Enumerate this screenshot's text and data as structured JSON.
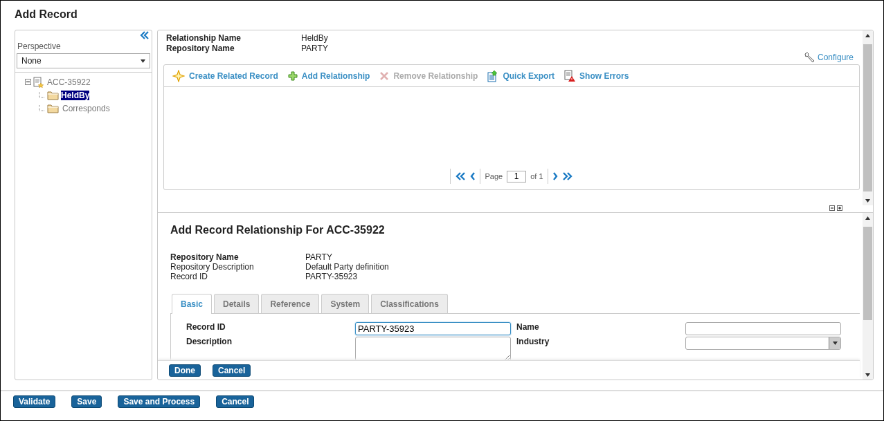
{
  "window": {
    "title": "Add Record"
  },
  "sidebar": {
    "perspective_label": "Perspective",
    "perspective_value": "None",
    "tree": [
      {
        "label": "ACC-35922",
        "expanded": true,
        "selected": false,
        "children": [
          {
            "label": "HeldBy",
            "selected": true
          },
          {
            "label": "Corresponds",
            "selected": false
          }
        ]
      }
    ]
  },
  "relationship": {
    "fields": [
      {
        "label": "Relationship Name",
        "value": "HeldBy"
      },
      {
        "label": "Repository Name",
        "value": "PARTY"
      }
    ],
    "configure": "Configure",
    "toolbar": [
      {
        "label": "Create Related Record",
        "disabled": false
      },
      {
        "label": "Add Relationship",
        "disabled": false
      },
      {
        "label": "Remove Relationship",
        "disabled": true
      },
      {
        "label": "Quick Export",
        "disabled": false
      },
      {
        "label": "Show Errors",
        "disabled": false
      }
    ],
    "pager": {
      "page_label": "Page",
      "page": "1",
      "of": "of 1"
    }
  },
  "form": {
    "title": "Add Record Relationship For ACC-35922",
    "info": [
      {
        "label": "Repository Name",
        "value": "PARTY",
        "bold": true
      },
      {
        "label": "Repository Description",
        "value": "Default Party definition",
        "bold": false
      },
      {
        "label": "Record ID",
        "value": "PARTY-35923",
        "bold": false
      }
    ],
    "tabs": [
      {
        "label": "Basic",
        "selected": true
      },
      {
        "label": "Details",
        "selected": false
      },
      {
        "label": "Reference",
        "selected": false
      },
      {
        "label": "System",
        "selected": false
      },
      {
        "label": "Classifications",
        "selected": false
      }
    ],
    "fields": [
      {
        "label": "Record ID",
        "kind": "text",
        "value": "PARTY-35923",
        "focused": true
      },
      {
        "label": "Name",
        "kind": "text",
        "focused": false
      },
      {
        "label": "Description",
        "kind": "textarea",
        "focused": false
      },
      {
        "label": "Industry",
        "kind": "select",
        "focused": false
      }
    ],
    "actions": [
      "Done",
      "Cancel"
    ]
  },
  "buttons": [
    "Validate",
    "Save",
    "Save and Process",
    "Cancel"
  ]
}
